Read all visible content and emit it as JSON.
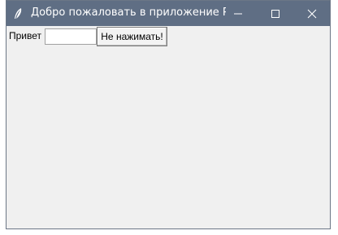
{
  "window": {
    "title": "Добро пожаловать в приложение Pytho...",
    "titlebar_color": "#5f6e84",
    "background_color": "#f0f0f0",
    "controls": {
      "minimize_icon": "minimize-icon",
      "maximize_icon": "maximize-icon",
      "close_icon": "close-icon"
    }
  },
  "form": {
    "label": "Привет",
    "input_value": "",
    "button_label": "Не нажимать!"
  }
}
